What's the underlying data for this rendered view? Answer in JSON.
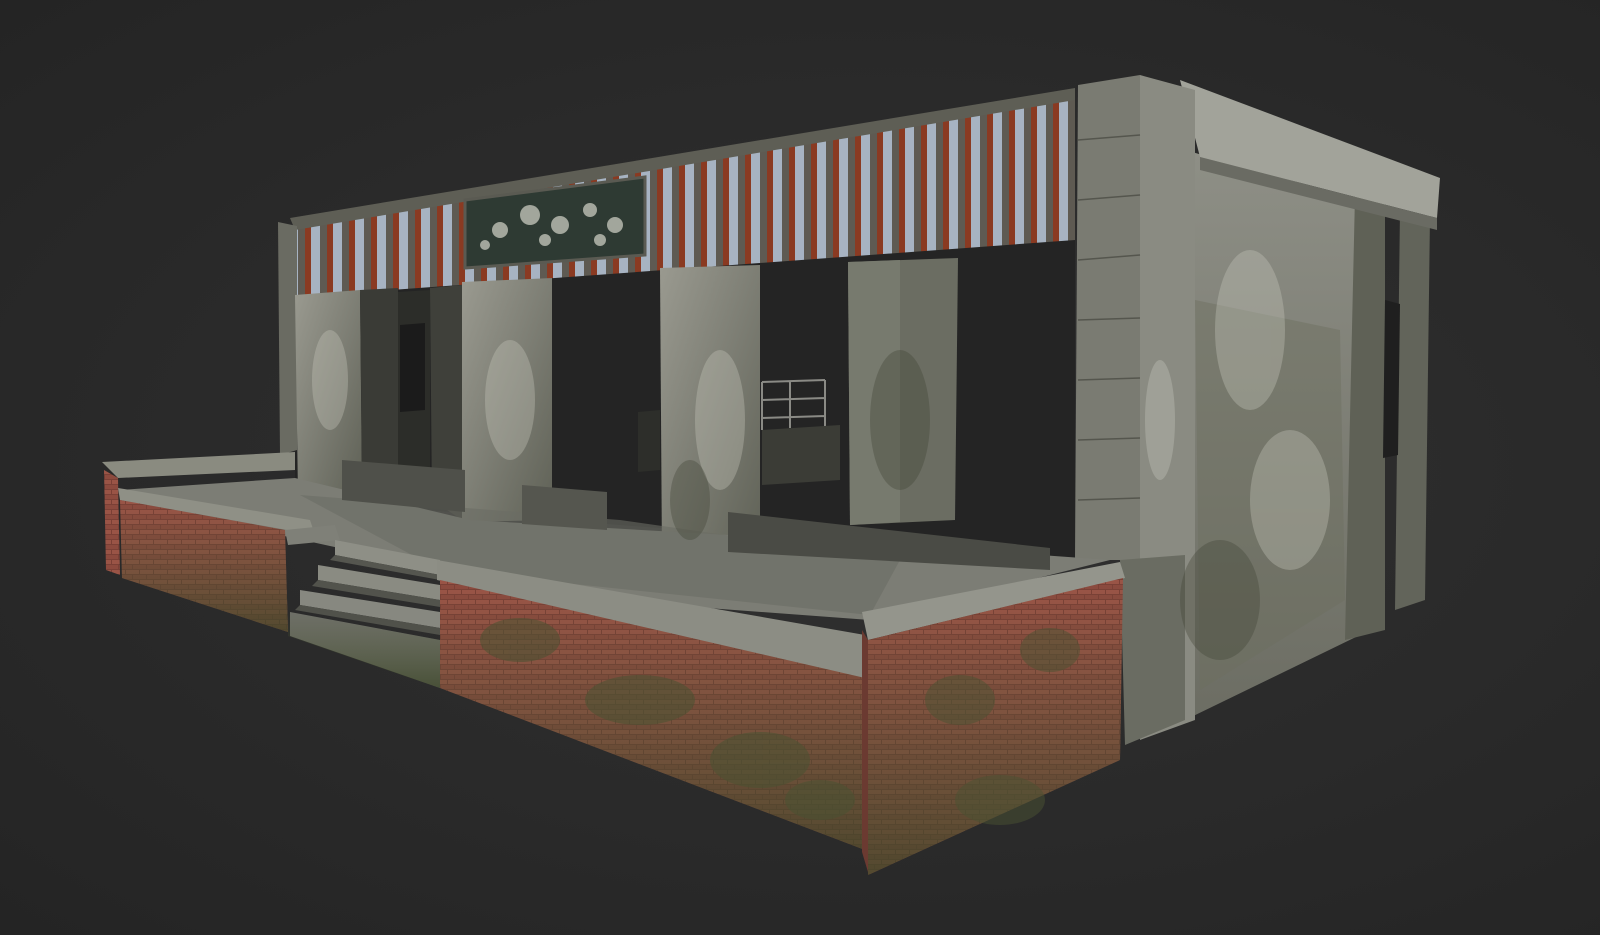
{
  "scene": {
    "background_color": "#2b2b2b",
    "subject": "ruined-building-3d-model",
    "materials": {
      "concrete": "#8a8a80",
      "concrete_dark": "#55564e",
      "brick": "#8a4a3e",
      "moss": "#4f5a38",
      "corrugated_metal": "#9aa8b8",
      "rust": "#8a3a22",
      "sign": "#2e3a33"
    }
  }
}
